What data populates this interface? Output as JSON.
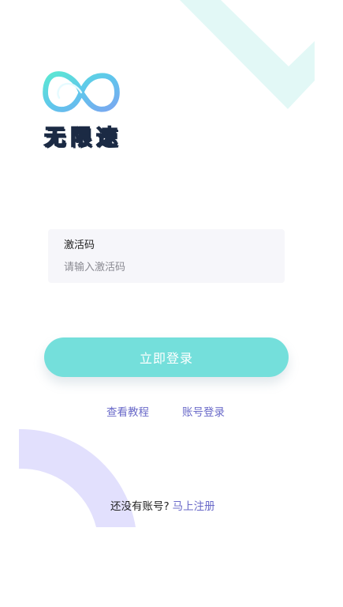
{
  "app": {
    "name": "无限速"
  },
  "colors": {
    "accent": "#74dfdb",
    "link": "#6a6ac9",
    "input_bg": "#f6f6fa",
    "deco_teal": "#e2f8f6",
    "deco_purple": "#e2e0fd"
  },
  "icons": {
    "logo": "infinity-logo-icon"
  },
  "form": {
    "activation_label": "激活码",
    "activation_placeholder": "请输入激活码",
    "activation_value": ""
  },
  "actions": {
    "login_label": "立即登录",
    "tutorial_label": "查看教程",
    "account_login_label": "账号登录"
  },
  "register": {
    "prompt": "还没有账号?",
    "link_label": "马上注册"
  }
}
